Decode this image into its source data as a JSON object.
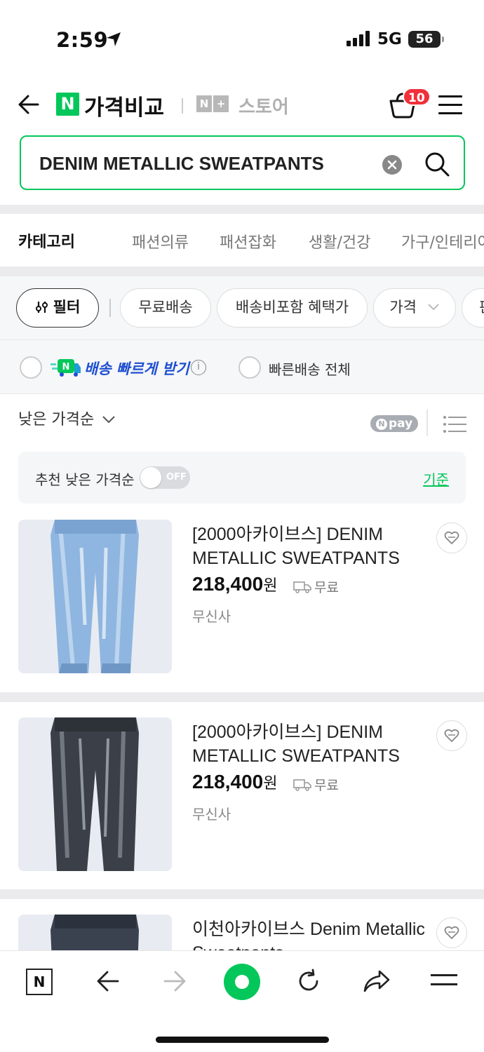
{
  "status_bar": {
    "time": "2:59",
    "network": "5G",
    "battery": "56"
  },
  "header": {
    "logo_n": "N",
    "logo_text": "가격비교",
    "store_badges": [
      "N",
      "+"
    ],
    "store_text": "스토어",
    "cart_count": "10",
    "icons": [
      "back-arrow-icon",
      "cart-icon",
      "hamburger-menu-icon"
    ]
  },
  "search": {
    "value": "DENIM METALLIC SWEATPANTS"
  },
  "category": {
    "title": "카테고리",
    "items": [
      "패션의류",
      "패션잡화",
      "생활/건강",
      "가구/인테리어"
    ]
  },
  "filters": {
    "filter_label": "필터",
    "chips": [
      "무료배송",
      "배송비포함 혜택가",
      "가격",
      "판"
    ]
  },
  "delivery": {
    "fast_delivery_label": "배송 빠르게 받기",
    "all_fast_label": "빠른배송 전체",
    "info_glyph": "i"
  },
  "sort": {
    "label": "낮은 가격순",
    "npay_label": "pay",
    "npay_n": "N"
  },
  "recommend": {
    "label": "추천 낮은 가격순",
    "toggle": "OFF",
    "criteria": "기준"
  },
  "products": [
    {
      "title": "[2000아카이브스] DENIM METALLIC SWEATPANTS (BL...",
      "price": "218,400",
      "currency": "원",
      "shipping": "무료",
      "mall": "무신사",
      "color": "light-blue"
    },
    {
      "title": "[2000아카이브스] DENIM METALLIC SWEATPANTS (G...",
      "price": "218,400",
      "currency": "원",
      "shipping": "무료",
      "mall": "무신사",
      "color": "dark-grey"
    },
    {
      "title": "이천아카이브스 Denim Metallic Sweatpants",
      "price": "",
      "currency": "",
      "shipping": "",
      "mall": "",
      "color": "dark-grey"
    }
  ],
  "bottom_bar": {
    "items": [
      "naver-home-icon",
      "back-icon",
      "forward-icon",
      "green-dot-icon",
      "refresh-icon",
      "share-icon",
      "menu-icon"
    ],
    "home_glyph": "N"
  },
  "colors": {
    "accent": "#03c75a",
    "badge": "#f0303b",
    "delivery_blue": "#1f4fd1"
  }
}
